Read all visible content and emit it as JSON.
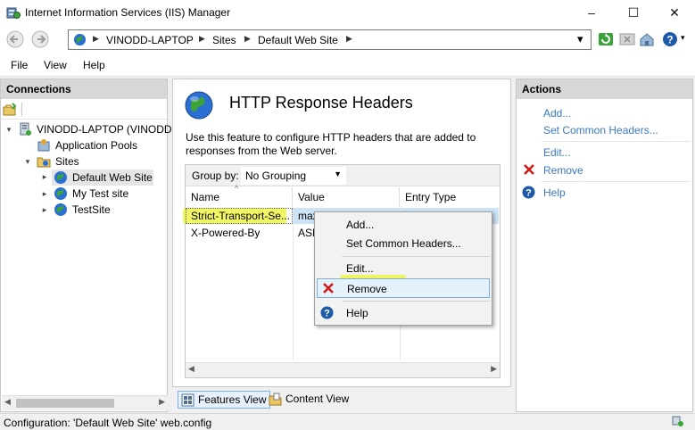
{
  "window": {
    "title": "Internet Information Services (IIS) Manager",
    "controls": {
      "minimize": "–",
      "maximize": "☐",
      "close": "✕"
    }
  },
  "address_bar": {
    "crumbs": [
      "VINODD-LAPTOP",
      "Sites",
      "Default Web Site"
    ],
    "separator": "▶",
    "dropdown_arrow": "▾"
  },
  "menu": [
    "File",
    "View",
    "Help"
  ],
  "connections": {
    "header": "Connections",
    "tree": [
      {
        "label": "VINODD-LAPTOP (VINODD-",
        "icon": "server-icon",
        "toggle": "▾"
      },
      {
        "label": "Application Pools",
        "icon": "app-pools-icon",
        "toggle": ""
      },
      {
        "label": "Sites",
        "icon": "sites-folder-icon",
        "toggle": "▾"
      },
      {
        "label": "Default Web Site",
        "icon": "globe-icon",
        "toggle": "▸"
      },
      {
        "label": "My Test site",
        "icon": "globe-icon",
        "toggle": "▸"
      },
      {
        "label": "TestSite",
        "icon": "globe-icon",
        "toggle": "▸"
      }
    ]
  },
  "feature": {
    "title": "HTTP Response Headers",
    "description": "Use this feature to configure HTTP headers that are added to responses from the Web server.",
    "group_by_label": "Group by:",
    "group_by_value": "No Grouping",
    "columns": [
      "Name",
      "Value",
      "Entry Type"
    ],
    "rows": [
      {
        "name": "Strict-Transport-Se...",
        "value": "max",
        "type": ""
      },
      {
        "name": "X-Powered-By",
        "value": "ASP",
        "type": ""
      }
    ]
  },
  "view_tabs": [
    "Features View",
    "Content View"
  ],
  "actions": {
    "header": "Actions",
    "items": [
      "Add...",
      "Set Common Headers...",
      "Edit...",
      "Remove",
      "Help"
    ]
  },
  "context_menu": {
    "items": [
      "Add...",
      "Set Common Headers...",
      "Edit...",
      "Remove",
      "Help"
    ],
    "highlighted": "Remove"
  },
  "status": {
    "text": "Configuration: 'Default Web Site' web.config"
  },
  "colors": {
    "accent_link": "#3b78c2",
    "highlight": "#eef63a",
    "remove_red": "#d11c1c",
    "help_blue": "#1e5aa8",
    "globe_blue": "#2a6fd1",
    "globe_green": "#3aa33a"
  }
}
